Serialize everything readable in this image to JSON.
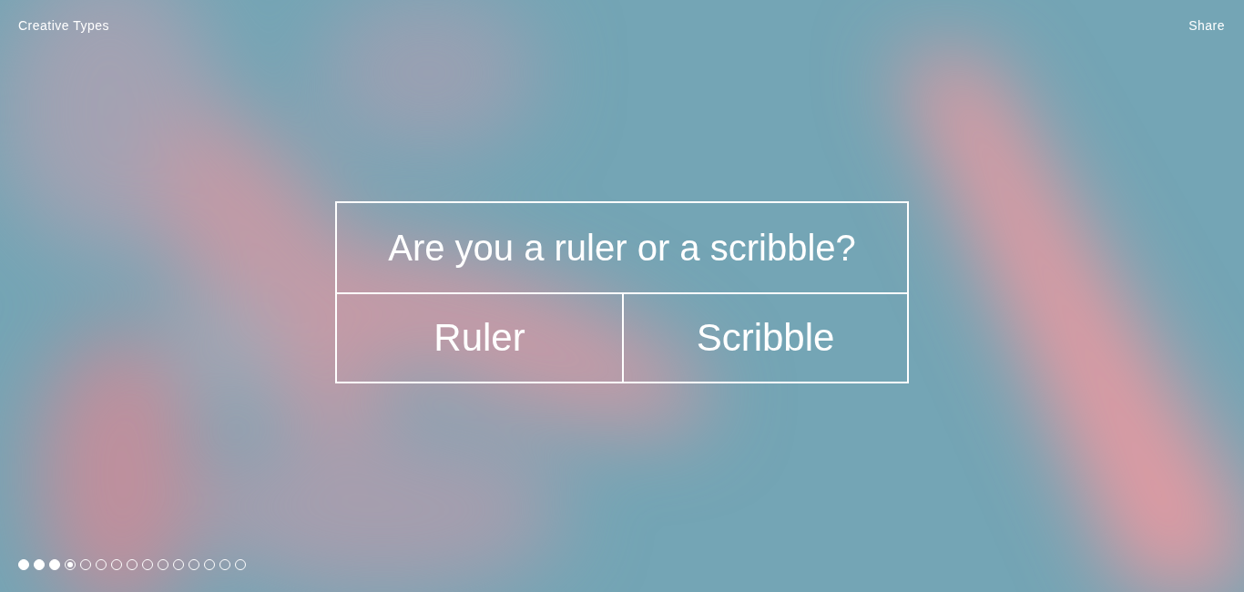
{
  "header": {
    "title": "Creative Types",
    "share": "Share"
  },
  "question": {
    "text": "Are you a ruler or a scribble?",
    "answers": [
      "Ruler",
      "Scribble"
    ]
  },
  "progress": [
    {
      "kind": "answered"
    },
    {
      "kind": "answered"
    },
    {
      "kind": "answered"
    },
    {
      "kind": "current"
    },
    {
      "kind": "upcoming"
    },
    {
      "kind": "upcoming"
    },
    {
      "kind": "upcoming"
    },
    {
      "kind": "upcoming"
    },
    {
      "kind": "upcoming"
    },
    {
      "kind": "upcoming"
    },
    {
      "kind": "upcoming"
    },
    {
      "kind": "upcoming"
    },
    {
      "kind": "upcoming"
    },
    {
      "kind": "upcoming"
    },
    {
      "kind": "upcoming"
    }
  ]
}
